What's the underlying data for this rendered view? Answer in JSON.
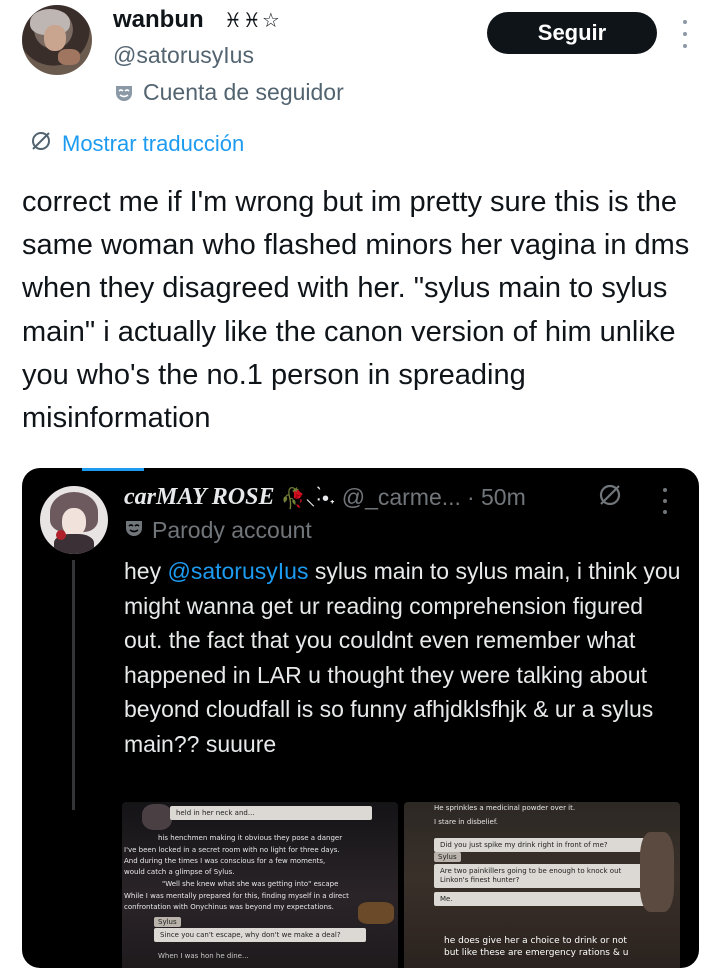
{
  "user": {
    "name": "wanbun",
    "name_decor": "♓︎♓︎☆",
    "handle": "@satorusyIus",
    "label_icon": "mask-icon",
    "label": "Cuenta de seguidor",
    "follow_label": "Seguir"
  },
  "translate": {
    "icon": "globe-slash-icon",
    "label": "Mostrar traducción"
  },
  "tweet": {
    "text": "correct me if I'm wrong but im pretty sure this is the same woman who flashed minors her vagina in dms when they disagreed with her. \"sylus main to sylus main\" i actually like the canon version of him unlike you who's the no.1 person in spreading misinformation"
  },
  "quote": {
    "name": "carMAY ROSE",
    "name_decor": "🥀⸜·̀•˖",
    "handle": "@_carme...",
    "time": "· 50m",
    "label": "Parody account",
    "text_before": "hey ",
    "mention": "@satorusyIus",
    "text_after": " sylus main to sylus main, i think you might wanna get ur reading comprehension figured out. the fact that you couldnt even remember what happened in LAR u thought they were talking about beyond cloudfall is so funny afhjdklsfhjk & ur a sylus main?? suuure",
    "shot1": {
      "bubble_top": "held in her neck and...",
      "lines": [
        "his henchmen making it obvious they pose a danger",
        "I've been locked in a secret room with no light for three days.",
        "And during the times I was conscious for a few moments,",
        "would catch a glimpse of Sylus.",
        "\"Well she knew what she was getting into\" escape",
        "While I was mentally prepared for this, finding myself in a direct",
        "confrontation with Onychinus was beyond my expectations."
      ],
      "speaker": "Sylus",
      "speech": "Since you can't escape, why don't we make a deal?",
      "bottom": "When I was hon he dine..."
    },
    "shot2": {
      "lines_top": [
        "He sprinkles a medicinal powder over it.",
        "I stare in disbelief."
      ],
      "bubbles": [
        "Did you just spike my drink right in front of me?",
        "Sylus",
        "Are two painkillers going to be enough to knock out Linkon's finest hunter?",
        "Me."
      ],
      "bottom_lines": [
        "he does give her a choice to drink or not",
        "but like these are emergency rations & u"
      ]
    }
  }
}
